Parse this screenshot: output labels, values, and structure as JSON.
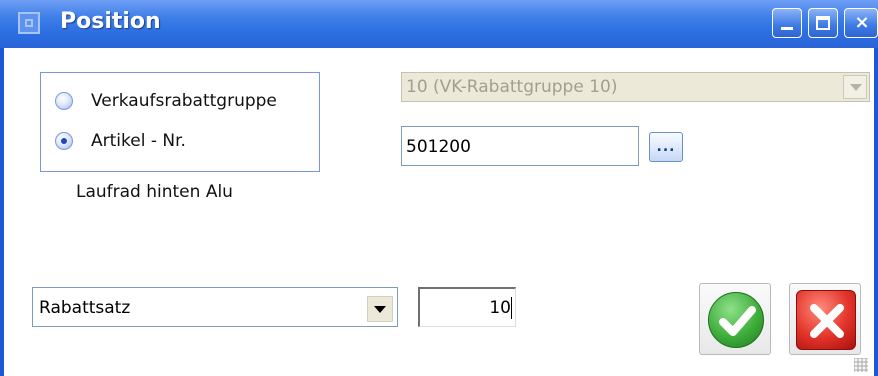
{
  "window": {
    "title": "Position",
    "accent_color": "#2b6ee2",
    "controls": {
      "minimize_icon": "minimize-icon",
      "maximize_icon": "maximize-icon",
      "close_glyph": "×"
    }
  },
  "selection": {
    "options": [
      {
        "label": "Verkaufsrabattgruppe",
        "checked": false
      },
      {
        "label": "Artikel - Nr.",
        "checked": true
      }
    ],
    "article_description": "Laufrad hinten Alu"
  },
  "discount_group_dropdown": {
    "value": "10 (VK-Rabattgruppe 10)",
    "disabled": true
  },
  "article_number": {
    "value": "501200",
    "browse_label": "..."
  },
  "rate": {
    "type_value": "Rabattsatz",
    "value": "10"
  },
  "actions": {
    "ok_icon": "checkmark-icon",
    "cancel_icon": "cross-icon",
    "ok_color": "#3fae3b",
    "cancel_color": "#e2332a"
  }
}
